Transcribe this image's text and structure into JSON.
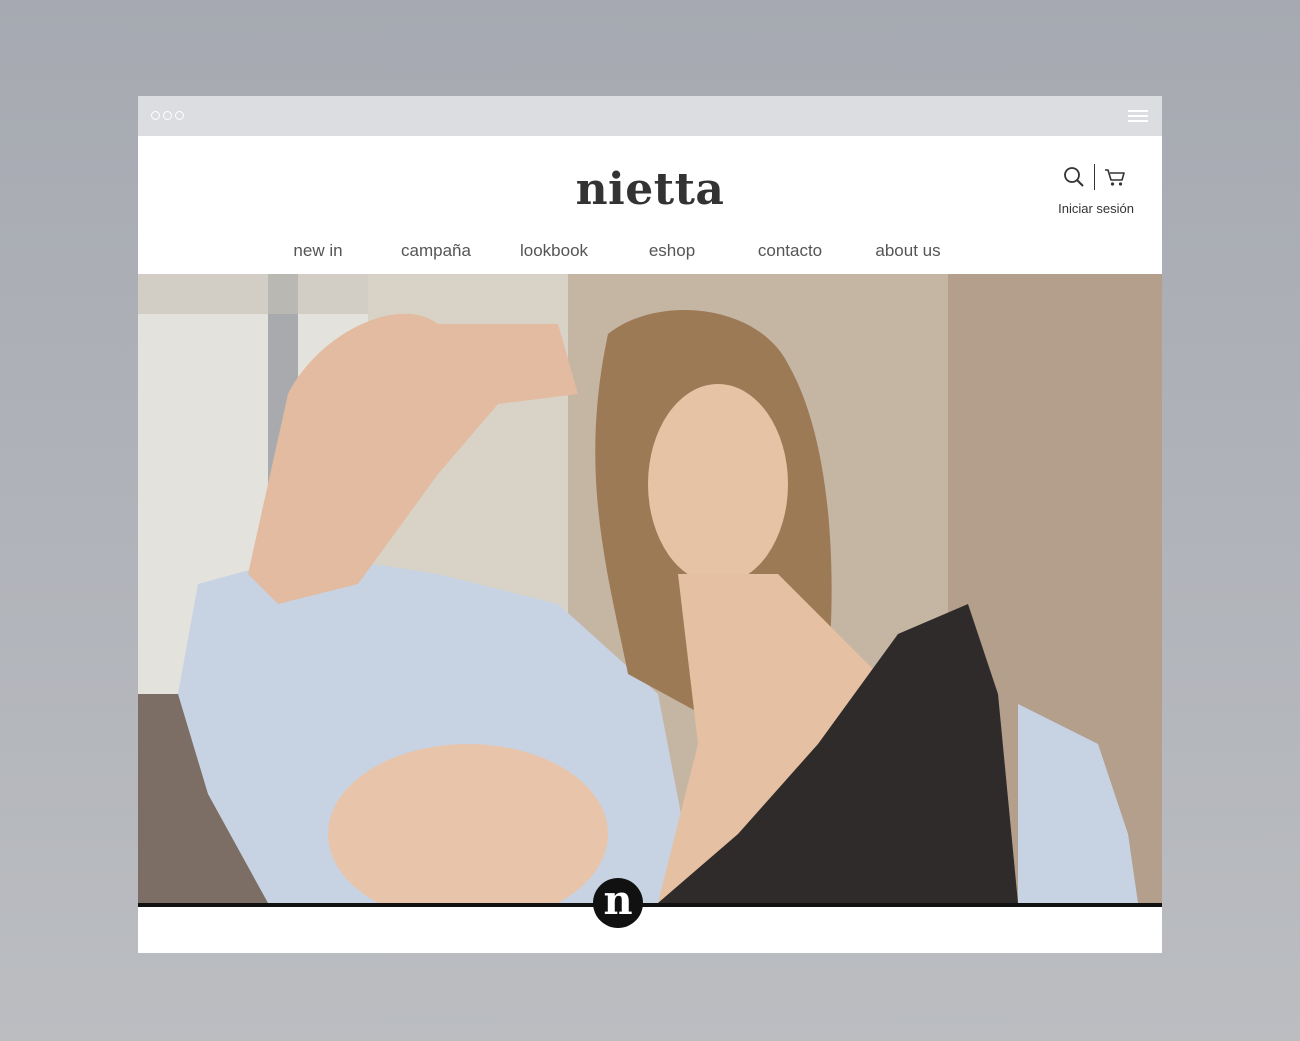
{
  "window": {
    "menu_icon": "hamburger-icon"
  },
  "brand": {
    "logo_text": "nietta",
    "badge_letter": "n"
  },
  "header": {
    "search_icon": "search-icon",
    "cart_icon": "cart-icon",
    "login_label": "Iniciar sesión"
  },
  "nav": {
    "items": [
      {
        "label": "new in"
      },
      {
        "label": "campaña"
      },
      {
        "label": "lookbook"
      },
      {
        "label": "eshop"
      },
      {
        "label": "contacto"
      },
      {
        "label": "about us"
      }
    ]
  },
  "hero": {
    "image_description_icon": "hero-photo"
  },
  "colors": {
    "page_background": "#adb0b6",
    "titlebar": "#dcdde0",
    "text_dark": "#333333",
    "nav_text": "#555555",
    "accent_black": "#111111"
  }
}
